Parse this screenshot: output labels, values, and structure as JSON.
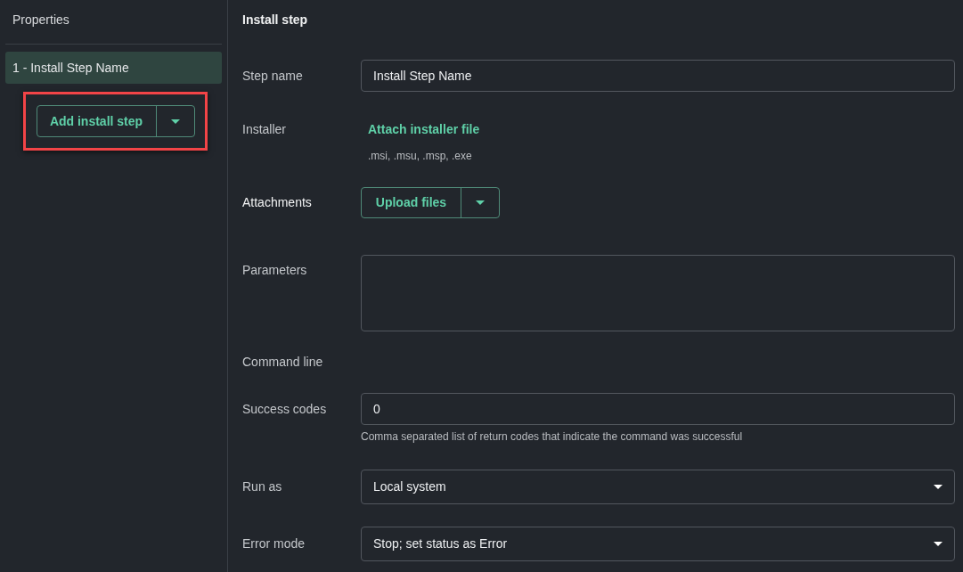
{
  "sidebar": {
    "title": "Properties",
    "items": [
      {
        "label": "1 - Install Step Name",
        "selected": true
      }
    ],
    "add_button": {
      "label": "Add install step",
      "highlighted": true
    }
  },
  "panel": {
    "title": "Install step",
    "fields": [
      {
        "kind": "text",
        "label": "Step name",
        "value": "Install Step Name"
      },
      {
        "kind": "link",
        "label": "Installer",
        "link": "Attach installer file",
        "hint": ".msi, .msu, .msp, .exe"
      },
      {
        "kind": "split",
        "label": "Attachments",
        "strong": true,
        "button": "Upload files"
      },
      {
        "kind": "textarea",
        "label": "Parameters"
      },
      {
        "kind": "plain",
        "label": "Command line"
      },
      {
        "kind": "text",
        "label": "Success codes",
        "value": "0",
        "hint": "Comma separated list of return codes that indicate the command was successful"
      },
      {
        "kind": "select",
        "label": "Run as",
        "value": "Local system"
      },
      {
        "kind": "select",
        "label": "Error mode",
        "value": "Stop; set status as Error"
      }
    ]
  }
}
